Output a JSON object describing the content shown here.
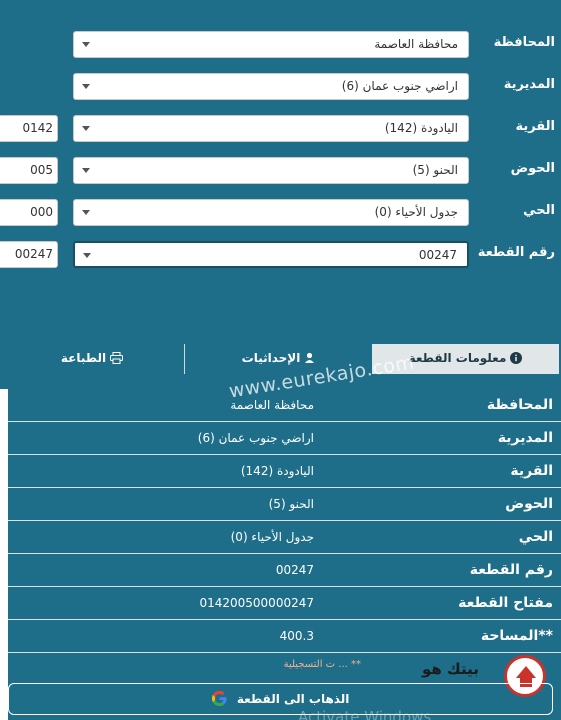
{
  "form": {
    "rows": [
      {
        "label": "المحافظة",
        "value": "محافظة العاصمة",
        "code": ""
      },
      {
        "label": "المديرية",
        "value": "اراضي جنوب عمان (6)",
        "code": ""
      },
      {
        "label": "القرية",
        "value": "اليادودة (142)",
        "code": "0142"
      },
      {
        "label": "الحوض",
        "value": "الحنو (5)",
        "code": "005"
      },
      {
        "label": "الحي",
        "value": "جدول الأحياء (0)",
        "code": "000"
      },
      {
        "label": "رقم القطعة",
        "value": "00247",
        "code": "00247"
      }
    ]
  },
  "tabs": {
    "info": "معلومات القطعة",
    "coordinates": "الإحداثيات",
    "print": "الطباعة"
  },
  "info": {
    "rows": [
      {
        "key": "المحافظة",
        "value": "محافظة العاصمة"
      },
      {
        "key": "المديرية",
        "value": "اراضي جنوب عمان (6)"
      },
      {
        "key": "القرية",
        "value": "اليادودة (142)"
      },
      {
        "key": "الحوض",
        "value": "الحنو (5)"
      },
      {
        "key": "الحي",
        "value": "جدول الأحياء (0)"
      },
      {
        "key": "رقم القطعة",
        "value": "00247"
      },
      {
        "key": "مفتاح القطعة",
        "value": "014200500000247"
      },
      {
        "key": "**المساحة",
        "value": "400.3"
      }
    ],
    "footnote": "** ... ت التسجيلية"
  },
  "go_button": "الذهاب الى القطعة",
  "watermark": "www.eurekajo.com",
  "logo_text": "بيتك هو",
  "activate_windows": "Activate Windows",
  "colors": {
    "background": "#1e6e8a",
    "active_tab": "#e1e6e8",
    "accent_red": "#c9332b"
  }
}
